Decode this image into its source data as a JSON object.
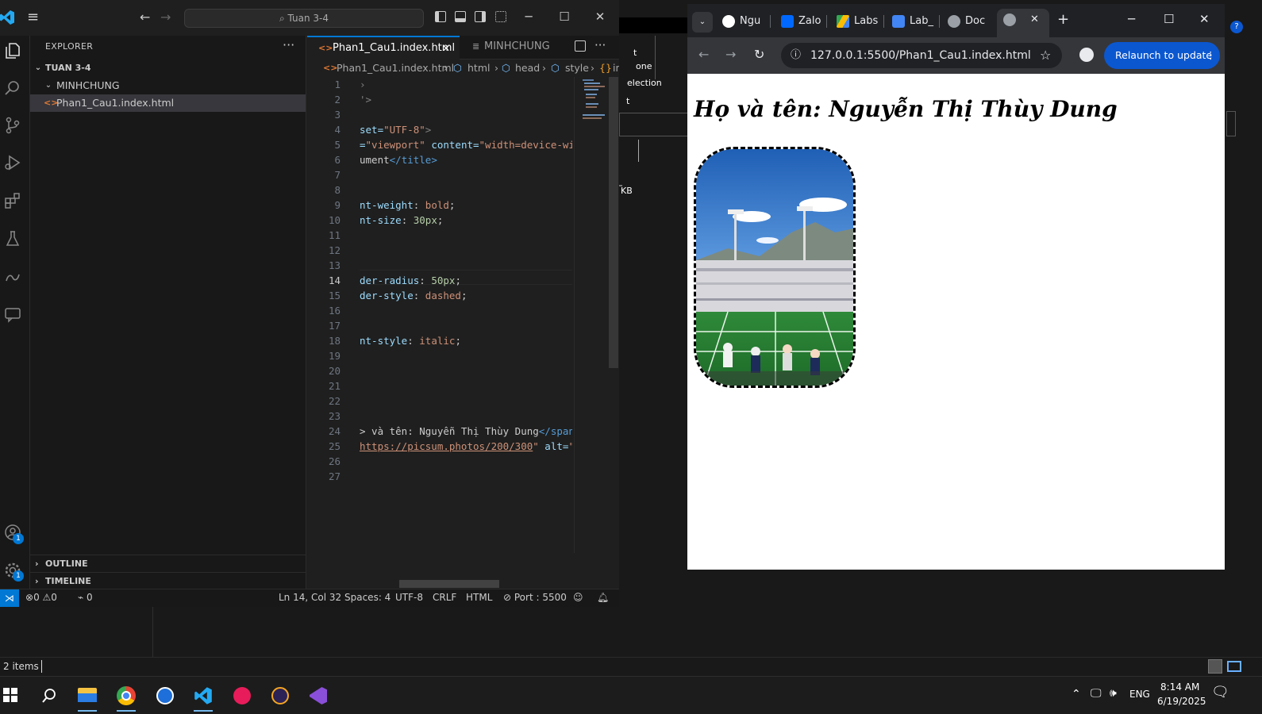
{
  "background_explorer": {
    "status_items": "2 items",
    "ribbon_fragments": [
      "one",
      "election",
      "t"
    ],
    "size_fragment": "KB"
  },
  "vscode": {
    "search_text": "Tuan 3-4",
    "sidebar": {
      "title": "EXPLORER",
      "more": "···",
      "workspace": "TUAN 3-4",
      "folder": "MINHCHUNG",
      "file": "Phan1_Cau1.index.html",
      "outline": "OUTLINE",
      "timeline": "TIMELINE"
    },
    "tabs": [
      {
        "label": "Phan1_Cau1.index.html",
        "close": "✕"
      },
      {
        "label": "MINHCHUNG"
      }
    ],
    "breadcrumb": [
      "Phan1_Cau1.index.html",
      "html",
      "head",
      "style",
      "in"
    ],
    "line_numbers": [
      "1",
      "2",
      "3",
      "4",
      "5",
      "6",
      "7",
      "8",
      "9",
      "10",
      "11",
      "12",
      "13",
      "14",
      "15",
      "16",
      "17",
      "18",
      "19",
      "20",
      "21",
      "22",
      "23",
      "24",
      "25",
      "26",
      "27"
    ],
    "current_line": "14",
    "code": {
      "l1": "›",
      "l2": "'>",
      "l4_a": "set=",
      "l4_b": "\"UTF-8\"",
      "l4_c": ">",
      "l5_a": "=",
      "l5_b": "\"viewport\"",
      "l5_c": " content=",
      "l5_d": "\"width=device-wi",
      "l6_a": "ument",
      "l6_b": "</title>",
      "l9_a": "nt-weight",
      "l9_b": ": ",
      "l9_c": "bold",
      "l9_d": ";",
      "l10_a": "nt-size",
      "l10_b": ": ",
      "l10_c": "30px",
      "l10_d": ";",
      "l14_a": "der-radius",
      "l14_b": ": ",
      "l14_c": "50px",
      "l14_d": ";",
      "l15_a": "der-style",
      "l15_b": ": ",
      "l15_c": "dashed",
      "l15_d": ";",
      "l18_a": "nt-style",
      "l18_b": ": ",
      "l18_c": "italic",
      "l18_d": ";",
      "l24_a": "> và tên: Nguyễn Thị Thùy Dung",
      "l24_b": "</span",
      "l25_a": "https://picsum.photos/200/300",
      "l25_b": "\"",
      "l25_c": " alt=",
      "l25_d": "\""
    },
    "status": {
      "errors": "0",
      "warnings": "0",
      "ports": "0",
      "position": "Ln 14, Col 32",
      "spaces": "Spaces: 4",
      "encoding": "UTF-8",
      "eol": "CRLF",
      "language": "HTML",
      "port": "Port : 5500"
    },
    "badges": {
      "accounts": "1",
      "manage": "1"
    }
  },
  "chrome": {
    "tabs": [
      {
        "label": "Ngu",
        "icon": "github-icon"
      },
      {
        "label": "Zalo",
        "icon": "zalo-icon"
      },
      {
        "label": "Labs",
        "icon": "drive-icon"
      },
      {
        "label": "Lab_",
        "icon": "docs-icon"
      },
      {
        "label": "Doc",
        "icon": "globe-icon"
      },
      {
        "label": "",
        "icon": "globe-icon"
      }
    ],
    "url": "127.0.0.1:5500/Phan1_Cau1.index.html",
    "relaunch": "Relaunch to update",
    "page": {
      "heading": "Họ và tên: Nguyễn Thị Thùy Dung"
    }
  },
  "taskbar": {
    "lang": "ENG",
    "time": "8:14 AM",
    "date": "6/19/2025"
  },
  "colors": {
    "accent": "#0078d4",
    "keyword": "#569cd6",
    "attr": "#9cdcfe",
    "string": "#ce9178",
    "number": "#b5cea8"
  }
}
